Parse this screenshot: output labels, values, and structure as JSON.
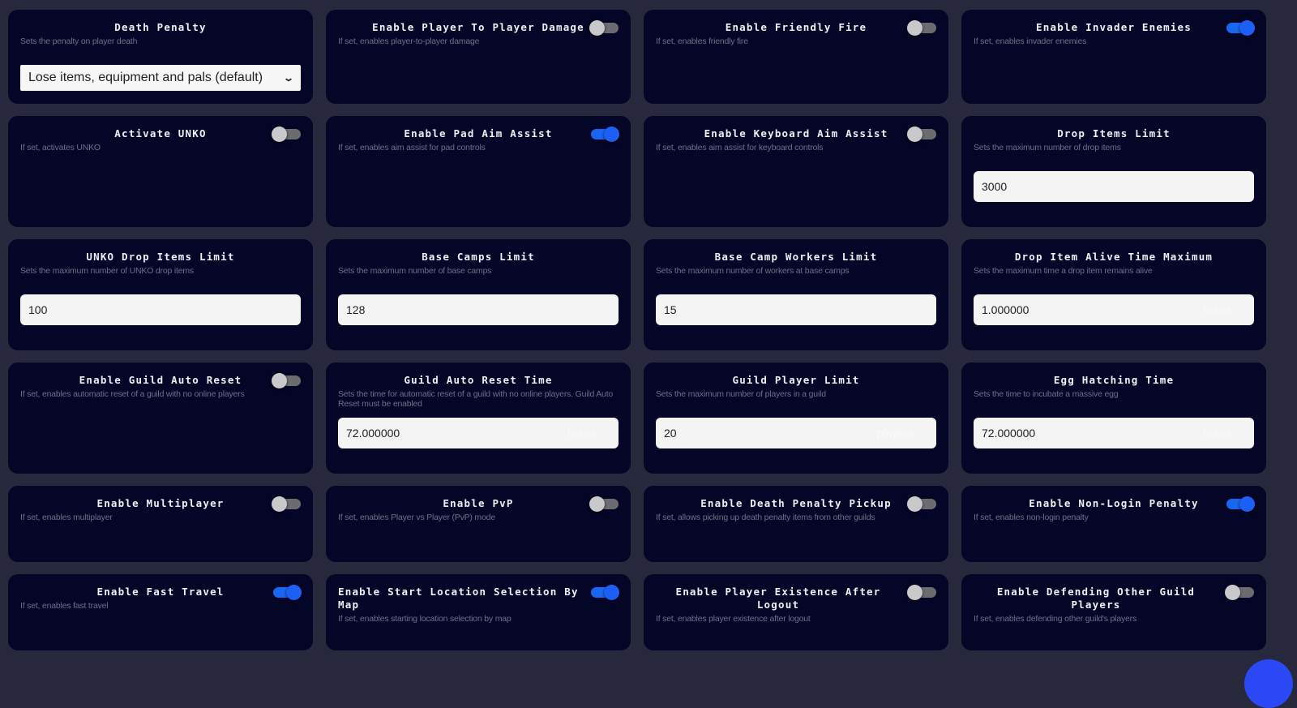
{
  "colors": {
    "page_bg": "#27283b",
    "card_bg": "#050627",
    "toggle_on": "#1c5ff5",
    "toggle_off": "#6b6b70",
    "fab": "#2a48f5"
  },
  "settings": [
    {
      "type": "select",
      "title": "Death Penalty",
      "desc": "Sets the penalty on player death",
      "value": "Lose items, equipment and pals (default)",
      "icon": "chevron-down-icon"
    },
    {
      "type": "toggle",
      "title": "Enable Player To Player Damage",
      "desc": "If set, enables player-to-player damage",
      "on": false
    },
    {
      "type": "toggle",
      "title": "Enable Friendly Fire",
      "desc": "If set, enables friendly fire",
      "on": false
    },
    {
      "type": "toggle",
      "title": "Enable Invader Enemies",
      "desc": "If set, enables invader enemies",
      "on": true
    },
    {
      "type": "toggle",
      "title": "Activate UNKO",
      "desc": "If set, activates UNKO",
      "on": false
    },
    {
      "type": "toggle",
      "title": "Enable Pad Aim Assist",
      "desc": "If set, enables aim assist for pad controls",
      "on": true
    },
    {
      "type": "toggle",
      "title": "Enable Keyboard Aim Assist",
      "desc": "If set, enables aim assist for keyboard controls",
      "on": false
    },
    {
      "type": "number",
      "title": "Drop Items Limit",
      "desc": "Sets the maximum number of drop items",
      "value": "3000",
      "unit": ""
    },
    {
      "type": "number",
      "title": "UNKO Drop Items Limit",
      "desc": "Sets the maximum number of UNKO drop items",
      "value": "100",
      "unit": ""
    },
    {
      "type": "number",
      "title": "Base Camps Limit",
      "desc": "Sets the maximum number of base camps",
      "value": "128",
      "unit": ""
    },
    {
      "type": "number",
      "title": "Base Camp Workers Limit",
      "desc": "Sets the maximum number of workers at base camps",
      "value": "15",
      "unit": ""
    },
    {
      "type": "number",
      "title": "Drop Item Alive Time Maximum",
      "desc": "Sets the maximum time a drop item remains alive",
      "value": "1.000000",
      "unit": "hours"
    },
    {
      "type": "toggle",
      "title": "Enable Guild Auto Reset",
      "desc": "If set, enables automatic reset of a guild with no online players",
      "on": false
    },
    {
      "type": "number",
      "title": "Guild Auto Reset Time",
      "desc": "Sets the time for automatic reset of a guild with no online players. Guild Auto Reset must be enabled",
      "value": "72.000000",
      "unit": "hours"
    },
    {
      "type": "number",
      "title": "Guild Player Limit",
      "desc": "Sets the maximum number of players in a guild",
      "value": "20",
      "unit": "players"
    },
    {
      "type": "number",
      "title": "Egg Hatching Time",
      "desc": "Sets the time to incubate a massive egg",
      "value": "72.000000",
      "unit": "hours"
    },
    {
      "type": "toggle",
      "title": "Enable Multiplayer",
      "desc": "If set, enables multiplayer",
      "on": false
    },
    {
      "type": "toggle",
      "title": "Enable PvP",
      "desc": "If set, enables Player vs Player (PvP) mode",
      "on": false
    },
    {
      "type": "toggle",
      "title": "Enable Death Penalty Pickup",
      "desc": "If set, allows picking up death penalty items from other guilds",
      "on": false
    },
    {
      "type": "toggle",
      "title": "Enable Non-Login Penalty",
      "desc": "If set, enables non-login penalty",
      "on": true
    },
    {
      "type": "toggle",
      "title": "Enable Fast Travel",
      "desc": "If set, enables fast travel",
      "on": true
    },
    {
      "type": "toggle",
      "title": "Enable Start Location Selection By Map",
      "desc": "If set, enables starting location selection by map",
      "on": true,
      "wide": true
    },
    {
      "type": "toggle",
      "title": "Enable Player Existence After Logout",
      "desc": "If set, enables player existence after logout",
      "on": false,
      "wide": true
    },
    {
      "type": "toggle",
      "title": "Enable Defending Other Guild Players",
      "desc": "If set, enables defending other guild's players",
      "on": false,
      "wide": true
    }
  ],
  "fab": {
    "icon": "action-button-icon"
  }
}
